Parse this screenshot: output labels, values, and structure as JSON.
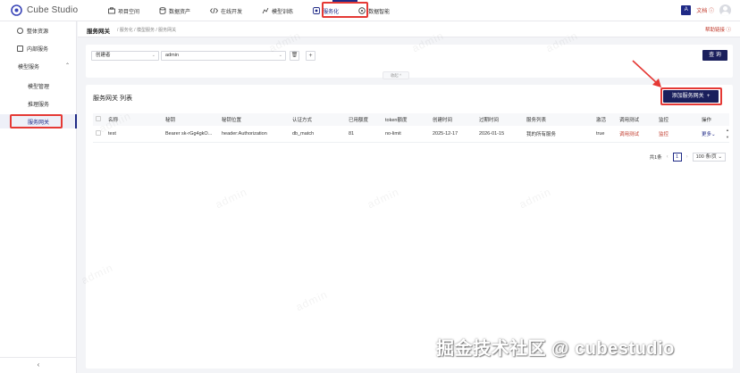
{
  "app": {
    "name": "Cube Studio"
  },
  "nav": [
    {
      "label": "项目空间",
      "icon": "briefcase-icon"
    },
    {
      "label": "数据资产",
      "icon": "database-icon"
    },
    {
      "label": "在线开发",
      "icon": "code-icon"
    },
    {
      "label": "模型训练",
      "icon": "training-icon"
    },
    {
      "label": "服务化",
      "icon": "service-icon",
      "active": true
    },
    {
      "label": "数据智能",
      "icon": "intelligence-icon"
    }
  ],
  "top_right": {
    "lang_icon": "A",
    "docs": "文档"
  },
  "sidebar": {
    "items": [
      {
        "label": "整体资源",
        "icon": "resource-icon"
      },
      {
        "label": "内部服务",
        "icon": "internal-service-icon"
      }
    ],
    "group": "模型服务",
    "sub_items": [
      {
        "label": "模型管理",
        "icon": "info-icon"
      },
      {
        "label": "推理服务",
        "icon": "inference-icon"
      },
      {
        "label": "服务网关",
        "icon": "gateway-icon",
        "active": true
      }
    ],
    "collapse": "‹"
  },
  "breadcrumb": {
    "title": "服务网关",
    "path": "/ 服务化 / 模型服务 / 服务网关",
    "help": "帮助链接"
  },
  "filter": {
    "field": "创建者",
    "value": "admin",
    "delete_icon": "🗑",
    "add_icon": "+",
    "query": "查 询",
    "fold": "收起 ^"
  },
  "list": {
    "title": "服务网关 列表",
    "add_button": "添加服务网关",
    "add_icon": "+",
    "columns": [
      "名称",
      "秘钥",
      "秘钥位置",
      "认证方式",
      "已用额度",
      "token额度",
      "创建时间",
      "过期时间",
      "服务列表",
      "激活",
      "调用测试",
      "监控",
      "操作"
    ],
    "rows": [
      {
        "name": "test",
        "key": "Bearer sk-rGg4gkO...",
        "key_position": "header:Authorization",
        "auth": "db_match",
        "used": "81",
        "token_quota": "no-limit",
        "created": "2025-12-17",
        "expires": "2026-01-15",
        "services": "我的所有服务",
        "active": "true",
        "test": "调用测试",
        "monitor": "监控",
        "more": "更多"
      }
    ],
    "pager": {
      "total": "共1条",
      "prev": "‹",
      "page": "1",
      "next": "›",
      "size": "100 条/页"
    }
  },
  "watermark": "admin",
  "footer_watermark": "掘金技术社区 @ cubestudio",
  "colors": {
    "brand": "#1a1f5c",
    "accent": "#c0392b",
    "highlight": "#e53935"
  }
}
